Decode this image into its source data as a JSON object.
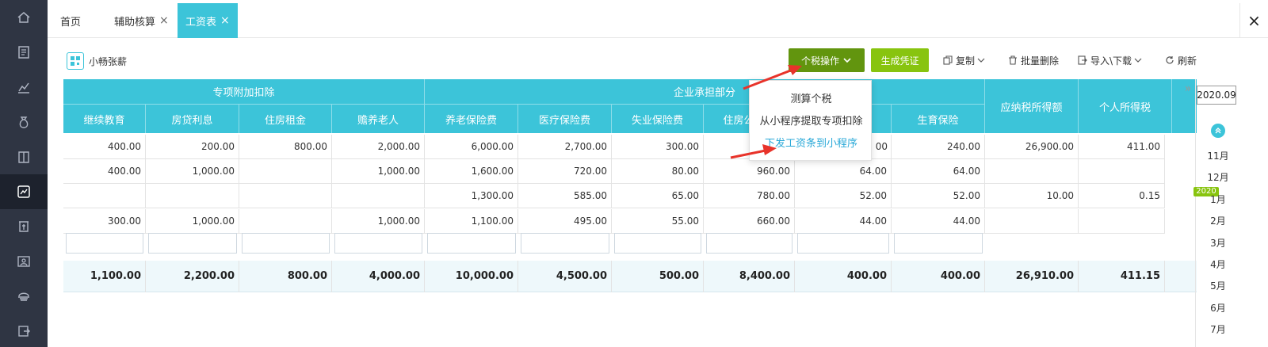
{
  "sidebar": {
    "items": [
      {
        "icon": "home-icon"
      },
      {
        "icon": "ledger-icon"
      },
      {
        "icon": "chart-icon"
      },
      {
        "icon": "money-bag-icon"
      },
      {
        "icon": "book-icon"
      },
      {
        "icon": "salary-icon"
      },
      {
        "icon": "invoice-icon"
      },
      {
        "icon": "contacts-icon"
      },
      {
        "icon": "archive-icon"
      },
      {
        "icon": "export-icon"
      }
    ],
    "active_index": 5
  },
  "tabs": {
    "items": [
      {
        "label": "首页",
        "closable": false
      },
      {
        "label": "辅助核算",
        "closable": true
      },
      {
        "label": "工资表",
        "closable": true
      }
    ],
    "close_glyph": "×",
    "window_close": "×"
  },
  "toolbar": {
    "brand_label": "小畅张薪",
    "tax_label": "个税操作",
    "voucher_label": "生成凭证",
    "copy_label": "复制",
    "batch_delete_label": "批量删除",
    "import_export_label": "导入\\下载",
    "refresh_label": "刷新"
  },
  "dropdown": {
    "items": [
      "测算个税",
      "从小程序提取专项扣除",
      "下发工资条到小程序"
    ]
  },
  "grid": {
    "groups": [
      "专项附加扣除",
      "企业承担部分"
    ],
    "columns": [
      "继续教育",
      "房贷利息",
      "住房租金",
      "赡养老人",
      "养老保险费",
      "医疗保险费",
      "失业保险费",
      "住房公积金",
      "",
      "生育保险",
      "应纳税所得额",
      "个人所得税"
    ],
    "rows": [
      [
        "400.00",
        "200.00",
        "800.00",
        "2,000.00",
        "6,000.00",
        "2,700.00",
        "300.00",
        "",
        "",
        "240.00",
        "26,900.00",
        "411.00"
      ],
      [
        "400.00",
        "1,000.00",
        "",
        "1,000.00",
        "1,600.00",
        "720.00",
        "80.00",
        "960.00",
        "64.00",
        "64.00",
        "",
        ""
      ],
      [
        "",
        "",
        "",
        "",
        "1,300.00",
        "585.00",
        "65.00",
        "780.00",
        "52.00",
        "52.00",
        "10.00",
        "0.15"
      ],
      [
        "300.00",
        "1,000.00",
        "",
        "1,000.00",
        "1,100.00",
        "495.00",
        "55.00",
        "660.00",
        "44.00",
        "44.00",
        "",
        ""
      ]
    ],
    "partial": {
      "row0_col8": "00"
    },
    "totals": [
      "1,100.00",
      "2,200.00",
      "800.00",
      "4,000.00",
      "10,000.00",
      "4,500.00",
      "500.00",
      "8,400.00",
      "400.00",
      "400.00",
      "26,910.00",
      "411.15"
    ]
  },
  "period": {
    "value": "2020.09",
    "collapse_glyph": "»",
    "year_badge": "2020",
    "months": [
      "11月",
      "12月",
      "1月",
      "2月",
      "3月",
      "4月",
      "5月",
      "6月",
      "7月"
    ]
  },
  "colors": {
    "accent": "#3cc4d9",
    "tax_button": "#62950e",
    "voucher_button": "#88c40f",
    "arrow": "#e8332a",
    "sidebar": "#2f3543"
  }
}
